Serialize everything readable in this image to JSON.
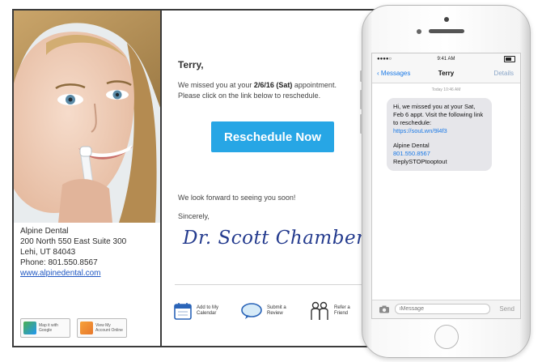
{
  "clinic": {
    "name": "Alpine Dental",
    "street": "200 North 550 East Suite 300",
    "city": "Lehi, UT 84043",
    "phone": "Phone: 801.550.8567",
    "website": "www.alpinedental.com"
  },
  "badges": {
    "map": "Map it with Google",
    "mobile": "View My Account Online"
  },
  "email": {
    "greeting": "Terry,",
    "missed_prefix": "We missed you at your ",
    "missed_date": "2/6/16 (Sat)",
    "missed_suffix": " appointment.",
    "missed_line2": "Please click on the link below to reschedule.",
    "reschedule_button": "Reschedule Now",
    "forward": "We look forward to seeing you soon!",
    "sincerely": "Sincerely,",
    "signature": "Dr. Scott Chamberlain",
    "actions": {
      "calendar": "Add to My Calendar",
      "review": "Submit a Review",
      "refer": "Refer a Friend"
    }
  },
  "phone": {
    "status_time": "9:41 AM",
    "back_label": "Messages",
    "contact": "Terry",
    "details": "Details",
    "timestamp": "Today 10:46 AM",
    "message_line1": "Hi, we missed you at your Sat, Feb 6 appt. Visit the following link to reschedule:",
    "message_link": "https://souLwn/9l4f3",
    "message_line2": "Alpine Dental",
    "message_phone": "801.550.8567",
    "message_optout": "ReplySTOPtooptout",
    "input_placeholder": "iMessage",
    "send_label": "Send"
  },
  "colors": {
    "accent": "#27a6e5",
    "signature": "#243b8e",
    "link": "#1f57c2",
    "ios_blue": "#1a79e6"
  }
}
